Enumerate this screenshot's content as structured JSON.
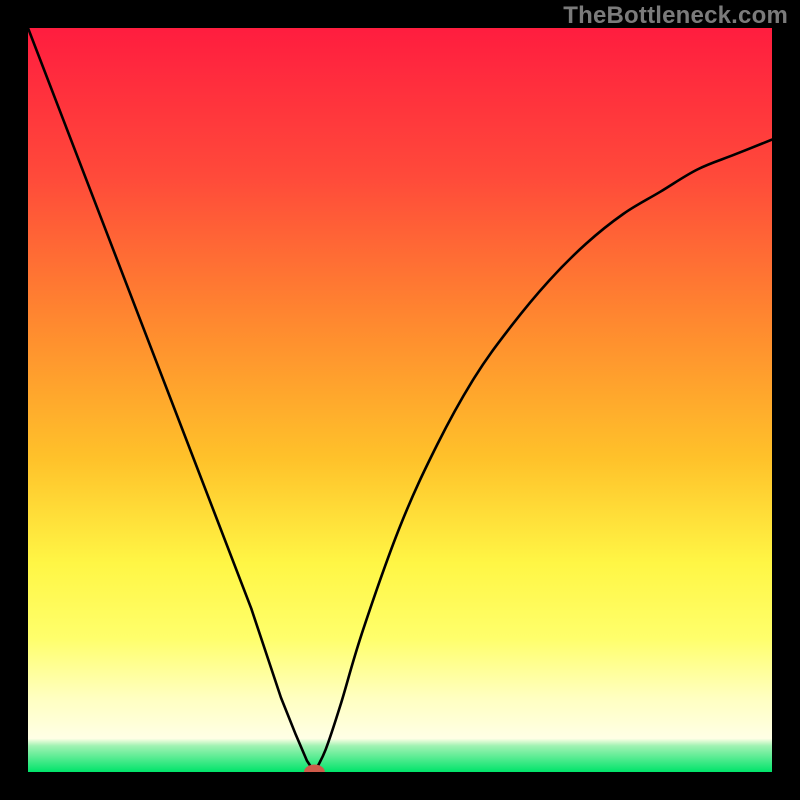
{
  "watermark": {
    "text": "TheBottleneck.com"
  },
  "chart_data": {
    "type": "line",
    "title": "",
    "xlabel": "",
    "ylabel": "",
    "xlim": [
      0,
      100
    ],
    "ylim": [
      0,
      100
    ],
    "grid": false,
    "legend": false,
    "background_gradient": {
      "stops": [
        {
          "offset": 0,
          "color": "#ff1d3f"
        },
        {
          "offset": 0.2,
          "color": "#ff4a3a"
        },
        {
          "offset": 0.4,
          "color": "#ff8a2f"
        },
        {
          "offset": 0.58,
          "color": "#ffc22a"
        },
        {
          "offset": 0.72,
          "color": "#fff645"
        },
        {
          "offset": 0.82,
          "color": "#ffff6b"
        },
        {
          "offset": 0.9,
          "color": "#ffffc0"
        },
        {
          "offset": 0.955,
          "color": "#ffffe6"
        },
        {
          "offset": 0.965,
          "color": "#9ff2b2"
        },
        {
          "offset": 1.0,
          "color": "#00e46a"
        }
      ]
    },
    "series": [
      {
        "name": "bottleneck-curve-left",
        "x": [
          0,
          5,
          10,
          15,
          20,
          25,
          30,
          34,
          36,
          37.5,
          38.5
        ],
        "values": [
          100,
          87,
          74,
          61,
          48,
          35,
          22,
          10,
          5,
          1.5,
          0
        ]
      },
      {
        "name": "bottleneck-curve-right",
        "x": [
          38.5,
          40,
          42,
          45,
          50,
          55,
          60,
          65,
          70,
          75,
          80,
          85,
          90,
          95,
          100
        ],
        "values": [
          0,
          3,
          9,
          19,
          33,
          44,
          53,
          60,
          66,
          71,
          75,
          78,
          81,
          83,
          85
        ]
      }
    ],
    "marker": {
      "x": 38.5,
      "y": 0,
      "rx": 1.4,
      "ry": 1.0,
      "color": "#cf5b4a"
    }
  }
}
